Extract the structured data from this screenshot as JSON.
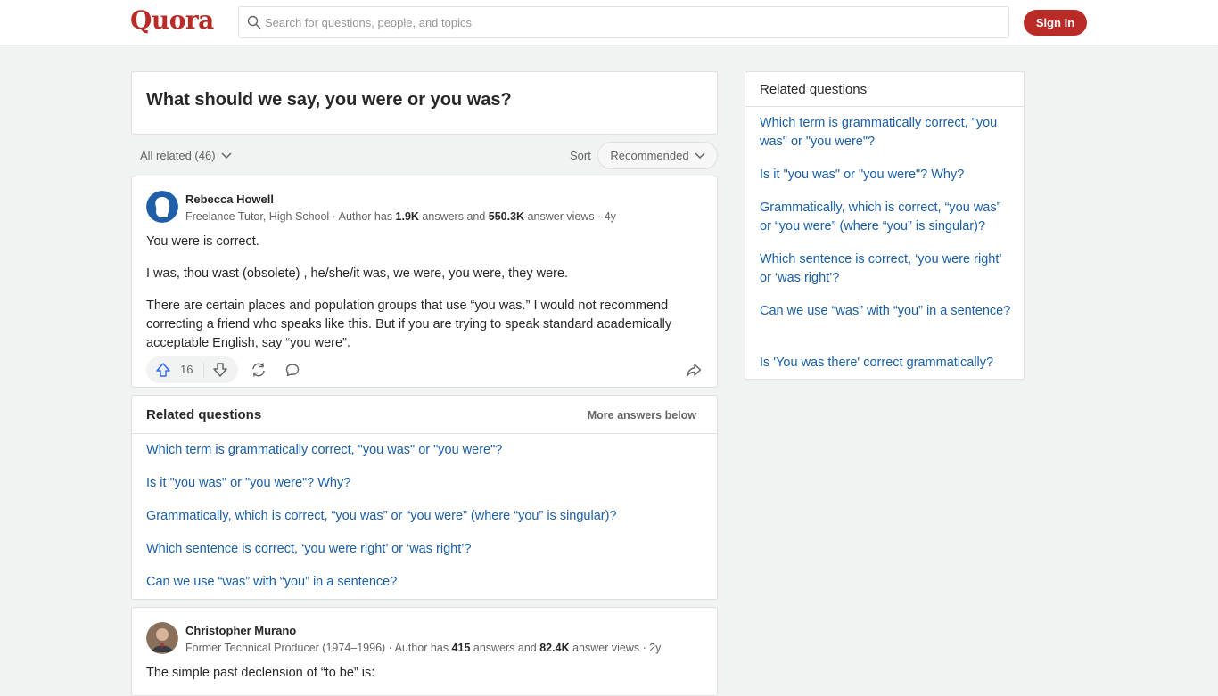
{
  "header": {
    "logo": "Quora",
    "search_placeholder": "Search for questions, people, and topics",
    "signin_label": "Sign In"
  },
  "question": {
    "title": "What should we say, you were or you was?"
  },
  "filter": {
    "all_related": "All related (46)",
    "sort_label": "Sort",
    "sort_value": "Recommended"
  },
  "answers": [
    {
      "author": "Rebecca Howell",
      "cred_prefix": "Freelance Tutor, High School · Author has ",
      "answers_count": "1.9K",
      "cred_mid": " answers and ",
      "views_count": "550.3K",
      "cred_suffix": " answer views · 4y",
      "paragraphs": [
        "You were is correct.",
        "I was, thou wast (obsolete) , he/she/it was, we were, you were, they were.",
        "There are certain places and population groups that use “you was.” I would not recommend correcting a friend who speaks like this. But if you are trying to speak standard academically acceptable English, say “you were”."
      ],
      "upvotes": "16"
    },
    {
      "author": "Christopher Murano",
      "cred_prefix": "Former Technical Producer (1974–1996) · Author has ",
      "answers_count": "415",
      "cred_mid": " answers and ",
      "views_count": "82.4K",
      "cred_suffix": " answer views · 2y",
      "paragraphs": [
        "The simple past declension of “to be” is:"
      ]
    }
  ],
  "related_feed": {
    "title": "Related questions",
    "more": "More answers below",
    "items": [
      "Which term is grammatically correct, \"you was\" or \"you were\"?",
      "Is it \"you was\" or \"you were\"? Why?",
      "Grammatically, which is correct, “you was” or “you were” (where “you” is singular)?",
      "Which sentence is correct, ‘you were right’ or ‘was right’?",
      "Can we use “was” with “you” in a sentence?"
    ]
  },
  "sidebar": {
    "title": "Related questions",
    "items": [
      "Which term is grammatically correct, \"you was\" or \"you were\"?",
      "Is it \"you was\" or \"you were\"? Why?",
      "Grammatically, which is correct, “you was” or “you were” (where “you” is singular)?",
      "Which sentence is correct, ‘you were right’ or ‘was right’?",
      "Can we use “was” with “you” in a sentence?",
      "Is 'You was there' correct grammatically?"
    ]
  },
  "colors": {
    "brand": "#b92b27",
    "link": "#195faa",
    "upvote": "#2e69ff"
  }
}
